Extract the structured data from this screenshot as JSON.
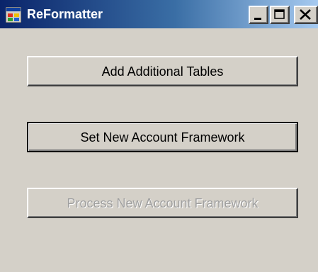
{
  "window": {
    "title": "ReFormatter",
    "icon": "app-form-icon",
    "caption_buttons": {
      "minimize": "minimize-icon",
      "maximize": "maximize-icon",
      "close": "close-icon"
    },
    "colors": {
      "title_gradient_start": "#0a246a",
      "title_gradient_end": "#a6caf0",
      "face": "#d4d0c8",
      "disabled_text": "#a0a0a0"
    }
  },
  "buttons": {
    "add_tables": {
      "label": "Add Additional Tables",
      "enabled": true
    },
    "set_framework": {
      "label": "Set New Account Framework",
      "enabled": true,
      "focused": true
    },
    "process_framework": {
      "label": "Process New Account Framework",
      "enabled": false
    }
  }
}
